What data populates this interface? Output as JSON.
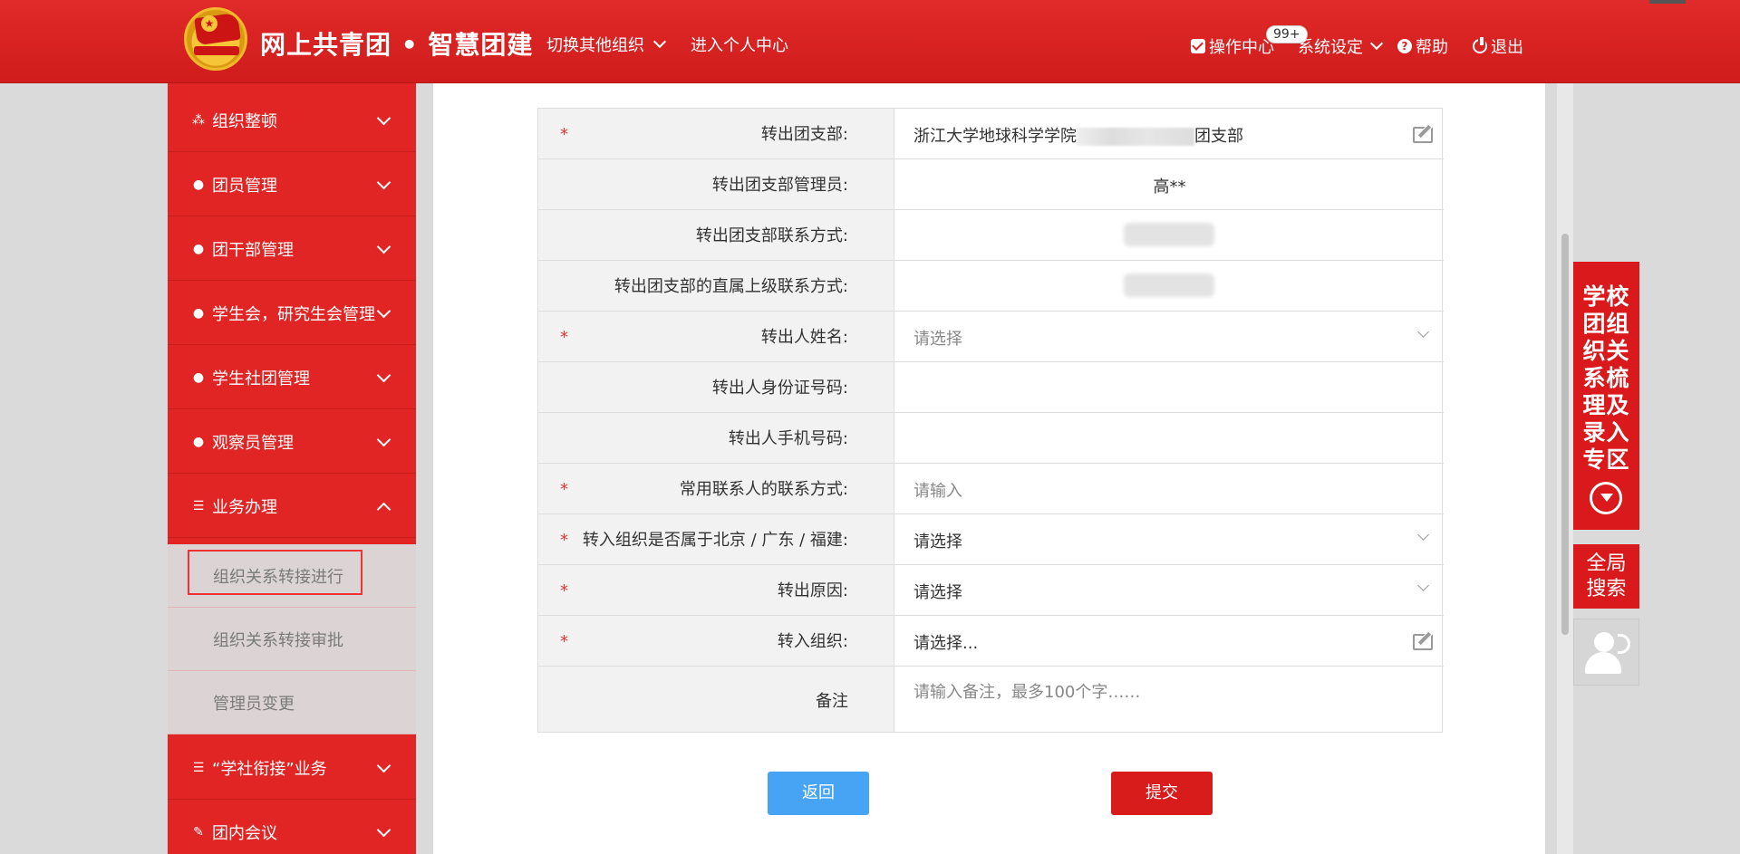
{
  "header": {
    "site_title": "网上共青团 • 智慧团建",
    "switch_org": "切换其他组织",
    "personal_center": "进入个人中心",
    "ops_center": "操作中心",
    "badge": "99+",
    "system_settings": "系统设定",
    "help": "帮助",
    "logout": "退出"
  },
  "sidebar": {
    "items": [
      {
        "label": "组织整顿",
        "icon": "org-chart-icon"
      },
      {
        "label": "团员管理",
        "icon": "users-icon"
      },
      {
        "label": "团干部管理",
        "icon": "users-icon"
      },
      {
        "label": "学生会，研究生会管理",
        "icon": "users-icon"
      },
      {
        "label": "学生社团管理",
        "icon": "users-icon"
      },
      {
        "label": "观察员管理",
        "icon": "users-icon"
      },
      {
        "label": "业务办理",
        "icon": "list-icon"
      }
    ],
    "sub_items": [
      "组织关系转接进行",
      "组织关系转接审批",
      "管理员变更"
    ],
    "bottom_items": [
      {
        "label": "“学社衔接”业务",
        "icon": "list-icon"
      },
      {
        "label": "团内会议",
        "icon": "edit-icon"
      }
    ]
  },
  "form": {
    "rows": [
      {
        "label": "转出团支部:",
        "required": true,
        "value_prefix": "浙江大学地球科学学院",
        "value_suffix": "团支部"
      },
      {
        "label": "转出团支部管理员:",
        "required": false,
        "value": "高**"
      },
      {
        "label": "转出团支部联系方式:",
        "required": false
      },
      {
        "label": "转出团支部的直属上级联系方式:",
        "required": false
      },
      {
        "label": "转出人姓名:",
        "required": true,
        "placeholder": "请选择"
      },
      {
        "label": "转出人身份证号码:",
        "required": false
      },
      {
        "label": "转出人手机号码:",
        "required": false
      },
      {
        "label": "常用联系人的联系方式:",
        "required": true,
        "placeholder": "请输入"
      },
      {
        "label": "转入组织是否属于北京 / 广东 / 福建:",
        "required": true,
        "placeholder": "请选择"
      },
      {
        "label": "转出原因:",
        "required": true,
        "placeholder": "请选择"
      },
      {
        "label": "转入组织:",
        "required": true,
        "placeholder": "请选择..."
      },
      {
        "label": "备注",
        "required": false,
        "placeholder": "请输入备注，最多100个字……"
      }
    ],
    "required_mark": "*"
  },
  "buttons": {
    "back": "返回",
    "submit": "提交"
  },
  "float": {
    "panel_text": "学校团组织关系梳理及录入专区",
    "search_line1": "全局",
    "search_line2": "搜索"
  },
  "colors": {
    "brand_red": "#d81c1c",
    "back_blue": "#47a4f5"
  }
}
